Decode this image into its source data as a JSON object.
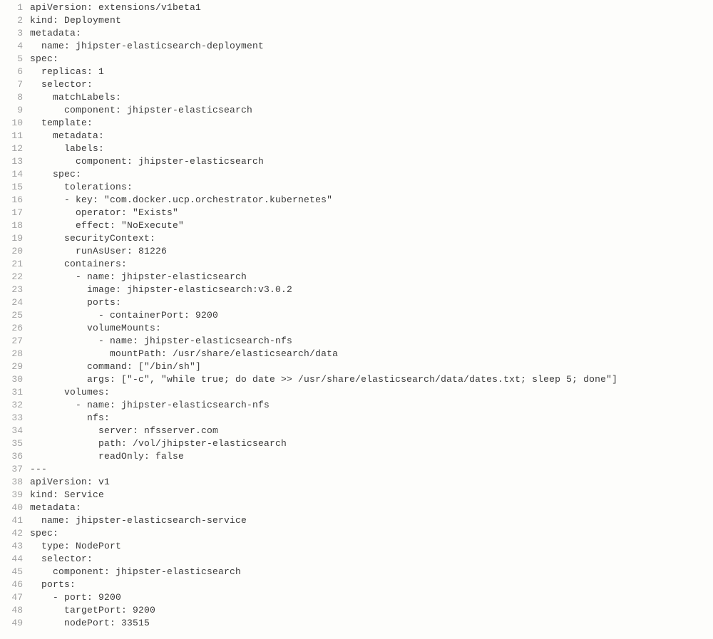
{
  "editor": {
    "start_line": 1,
    "lines": [
      "apiVersion: extensions/v1beta1",
      "kind: Deployment",
      "metadata:",
      "  name: jhipster-elasticsearch-deployment",
      "spec:",
      "  replicas: 1",
      "  selector:",
      "    matchLabels:",
      "      component: jhipster-elasticsearch",
      "  template:",
      "    metadata:",
      "      labels:",
      "        component: jhipster-elasticsearch",
      "    spec:",
      "      tolerations:",
      "      - key: \"com.docker.ucp.orchestrator.kubernetes\"",
      "        operator: \"Exists\"",
      "        effect: \"NoExecute\"",
      "      securityContext:",
      "        runAsUser: 81226",
      "      containers:",
      "        - name: jhipster-elasticsearch",
      "          image: jhipster-elasticsearch:v3.0.2",
      "          ports:",
      "            - containerPort: 9200",
      "          volumeMounts:",
      "            - name: jhipster-elasticsearch-nfs",
      "              mountPath: /usr/share/elasticsearch/data",
      "          command: [\"/bin/sh\"]",
      "          args: [\"-c\", \"while true; do date >> /usr/share/elasticsearch/data/dates.txt; sleep 5; done\"]",
      "      volumes:",
      "        - name: jhipster-elasticsearch-nfs",
      "          nfs:",
      "            server: nfsserver.com",
      "            path: /vol/jhipster-elasticsearch",
      "            readOnly: false",
      "---",
      "apiVersion: v1",
      "kind: Service",
      "metadata:",
      "  name: jhipster-elasticsearch-service",
      "spec:",
      "  type: NodePort",
      "  selector:",
      "    component: jhipster-elasticsearch",
      "  ports:",
      "    - port: 9200",
      "      targetPort: 9200",
      "      nodePort: 33515"
    ]
  }
}
